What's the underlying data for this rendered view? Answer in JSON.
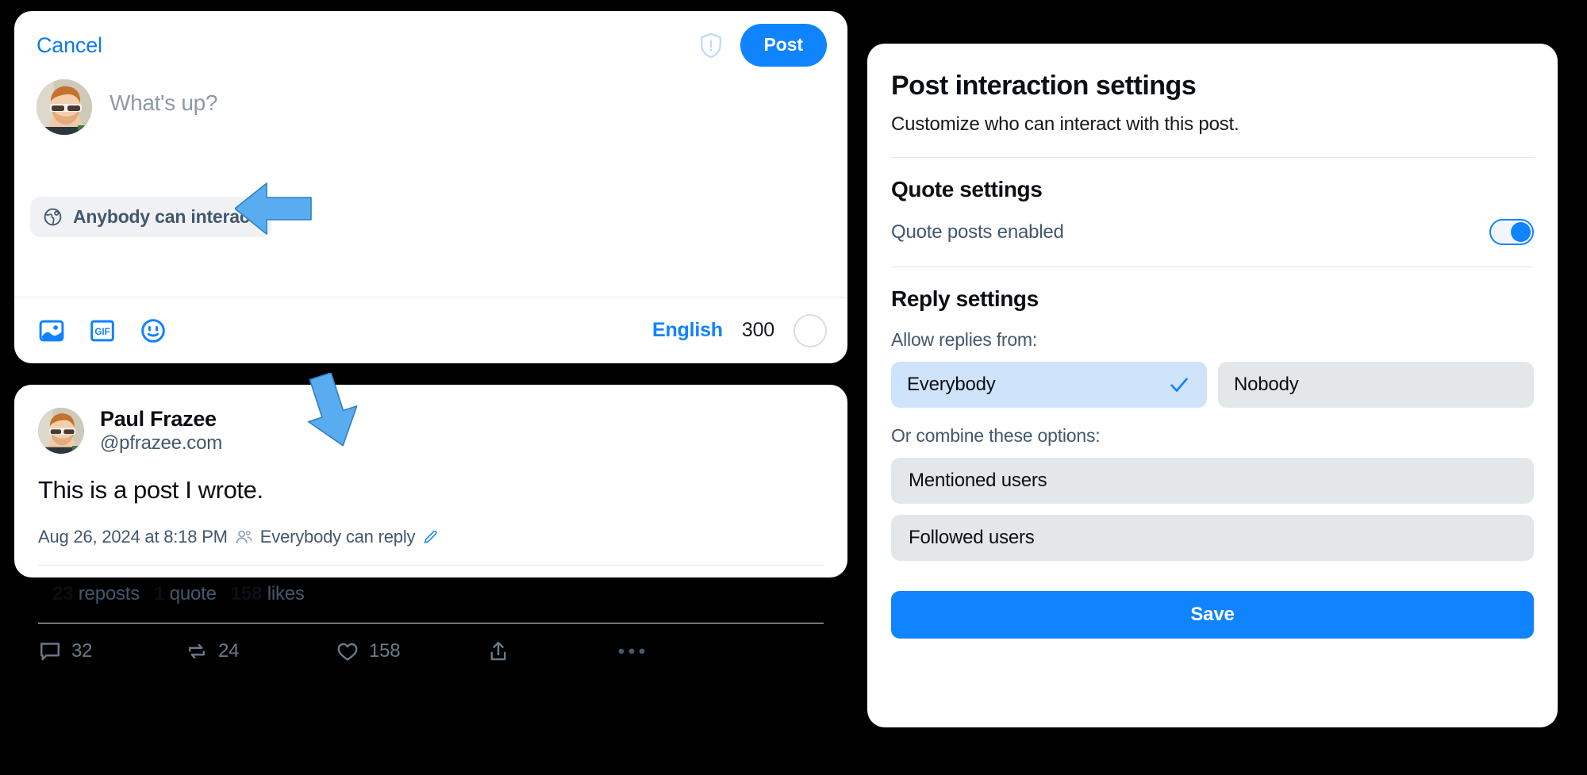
{
  "composer": {
    "cancel_label": "Cancel",
    "post_label": "Post",
    "shield_icon": "shield-alert-icon",
    "avatar_icon": "user-avatar",
    "placeholder": "What's up?",
    "interaction_pill": {
      "icon": "globe-icon",
      "label": "Anybody can interact"
    },
    "footer": {
      "image_icon": "image-icon",
      "gif_icon": "gif-icon",
      "emoji_icon": "emoji-icon",
      "language_label": "English",
      "char_count": "300",
      "char_ring_icon": "progress-ring-icon"
    }
  },
  "post": {
    "avatar_icon": "user-avatar",
    "display_name": "Paul Frazee",
    "handle": "@pfrazee.com",
    "text": "This is a post I wrote.",
    "timestamp": "Aug 26, 2024 at 8:18 PM",
    "audience_icon": "people-icon",
    "audience_label": "Everybody can reply",
    "edit_icon": "pencil-icon",
    "stats": {
      "reposts_count": "23",
      "reposts_label": "reposts",
      "quotes_count": "1",
      "quotes_label": "quote",
      "likes_count": "158",
      "likes_label": "likes"
    },
    "actions": {
      "reply_icon": "comment-icon",
      "reply_count": "32",
      "repost_icon": "repost-icon",
      "repost_count": "24",
      "like_icon": "heart-icon",
      "like_count": "158",
      "share_icon": "share-icon",
      "more_icon": "ellipsis-icon"
    }
  },
  "settings": {
    "title": "Post interaction settings",
    "subtitle": "Customize who can interact with this post.",
    "quote_section_title": "Quote settings",
    "quote_toggle_label": "Quote posts enabled",
    "quote_toggle_on": true,
    "reply_section_title": "Reply settings",
    "allow_replies_label": "Allow replies from:",
    "choices": [
      {
        "label": "Everybody",
        "selected": true,
        "check_icon": "check-icon"
      },
      {
        "label": "Nobody",
        "selected": false
      }
    ],
    "combine_label": "Or combine these options:",
    "options": [
      {
        "label": "Mentioned users"
      },
      {
        "label": "Followed users"
      }
    ],
    "save_label": "Save"
  },
  "annotations": [
    {
      "name": "arrow-pointing-to-interaction-pill",
      "direction": "left",
      "color": "#59acf0"
    },
    {
      "name": "arrow-pointing-to-reply-settings",
      "direction": "down",
      "color": "#59acf0"
    }
  ],
  "colors": {
    "accent": "#1083fe",
    "link": "#0f7aeb",
    "muted": "#42576c",
    "chip_bg": "#e3e7ea",
    "chip_selected_bg": "#cfe4fb",
    "annotation_blue": "#59acf0"
  }
}
